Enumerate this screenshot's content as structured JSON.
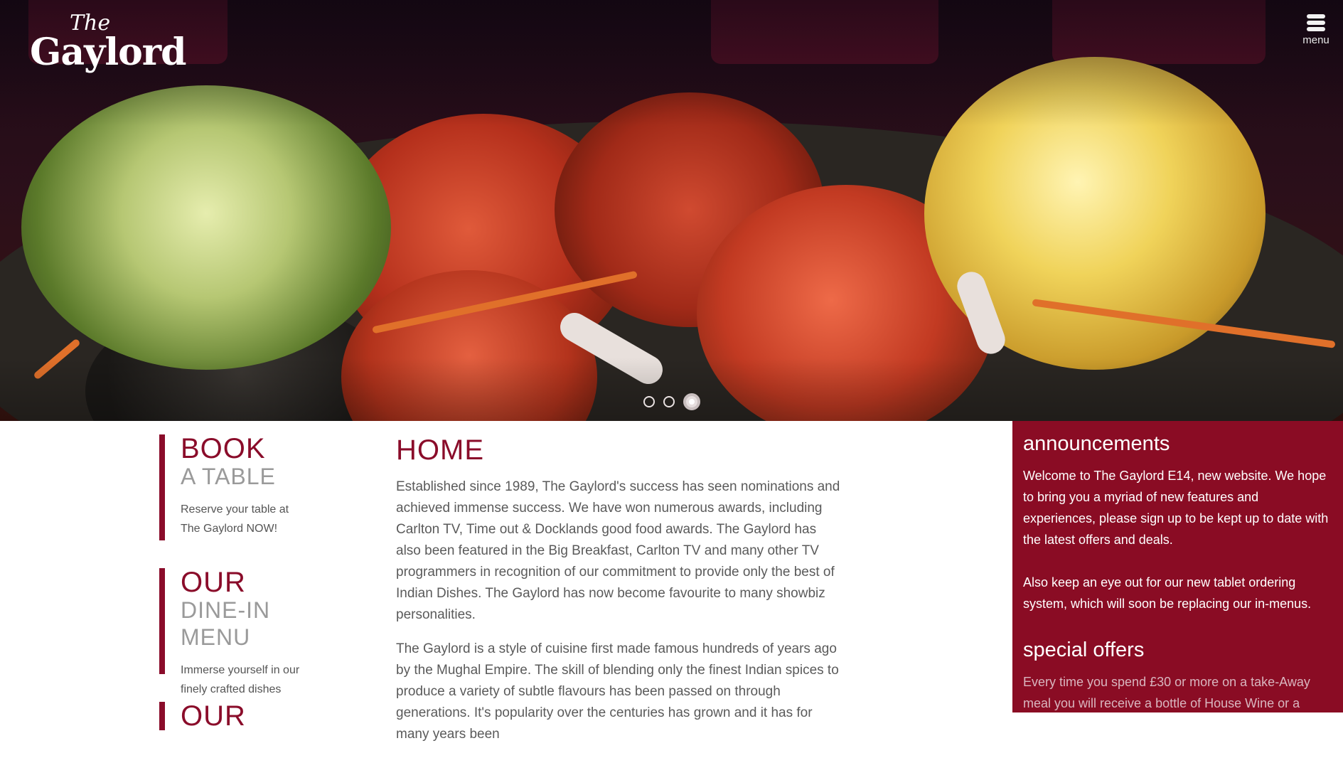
{
  "brand": {
    "logo_the": "The",
    "logo_name": "Gaylord"
  },
  "header": {
    "menu_label": "menu"
  },
  "carousel": {
    "slides": 3,
    "active_index": 2
  },
  "sidebar_ctas": [
    {
      "title_top": "BOOK",
      "title_bottom": "A TABLE",
      "desc_line1": "Reserve your table at",
      "desc_line2": "The Gaylord NOW!"
    },
    {
      "title_top": "OUR",
      "title_bottom": "DINE-IN MENU",
      "desc_line1": "Immerse yourself in our",
      "desc_line2": "finely crafted dishes"
    },
    {
      "title_top": "OUR"
    }
  ],
  "main": {
    "heading": "HOME",
    "paragraph1": "Established since 1989, The Gaylord's success has seen nominations and achieved immense success. We have won numerous awards, including Carlton TV, Time out & Docklands good food awards. The Gaylord has also been featured in the Big Breakfast, Carlton TV and many other TV programmers in recognition of our commitment to provide only the best of Indian Dishes. The Gaylord has now become favourite to many showbiz personalities.",
    "paragraph2": "The Gaylord is a style of cuisine first made famous hundreds of years ago by the Mughal Empire. The skill of blending only the finest Indian spices to produce a variety of subtle flavours has been passed on through generations. It's popularity over the centuries has grown and it has for many years been"
  },
  "announcements": {
    "heading": "announcements",
    "text1": "Welcome to The Gaylord E14, new website. We hope to bring you a myriad of new features and experiences, please sign up to be kept up to date with the latest offers and deals.",
    "text2": "Also keep an eye out for our new tablet ordering system, which will soon be replacing our in-menus."
  },
  "special_offers": {
    "heading": "special offers",
    "text": "Every time you spend £30 or more on a take-Away meal you will receive a bottle of House Wine or a Gaylord"
  },
  "colors": {
    "brand": "#8a0c2a",
    "sidebar_bg": "#8a0c24"
  }
}
